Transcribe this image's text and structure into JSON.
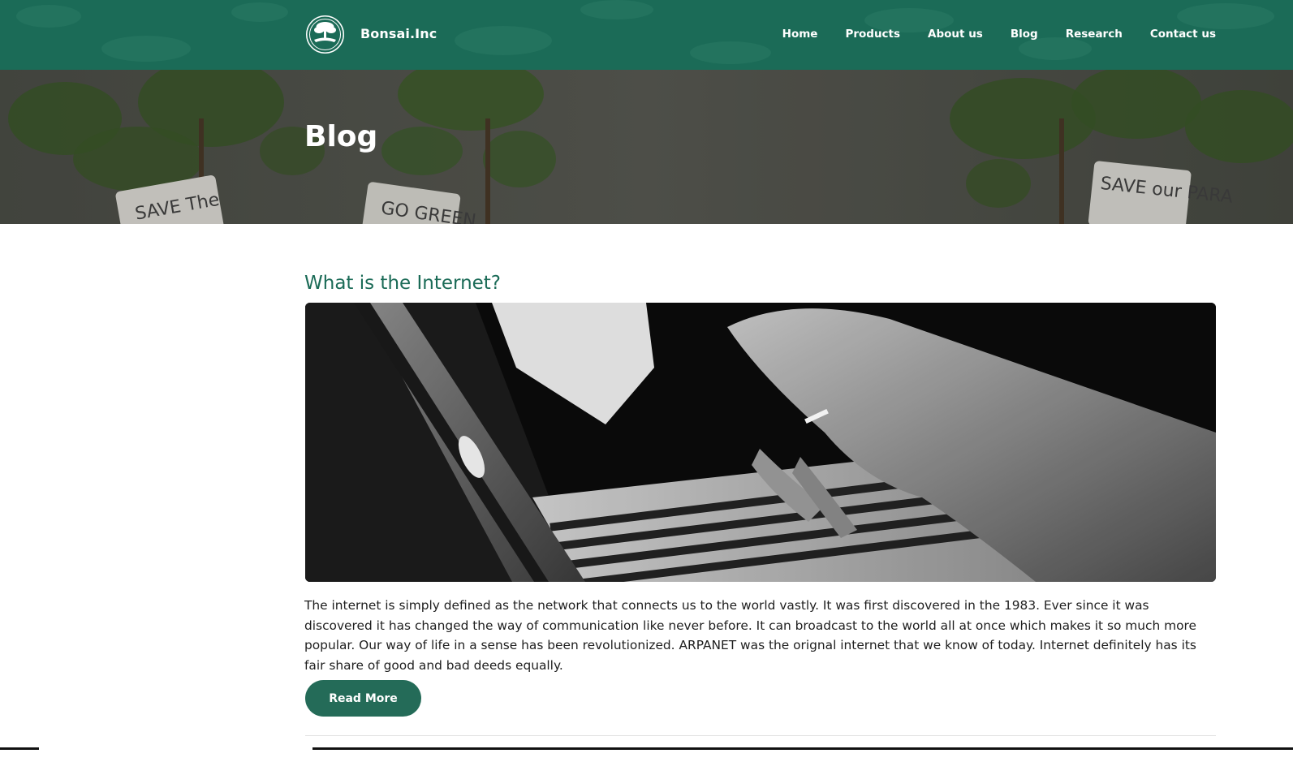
{
  "header": {
    "brand": "Bonsai.Inc",
    "logo_text": "Bonsai plants",
    "nav": [
      "Home",
      "Products",
      "About us",
      "Blog",
      "Research",
      "Contact us"
    ]
  },
  "hero": {
    "title": "Blog",
    "sign_texts": [
      "SAVE The",
      "GO GREEN",
      "SAVE our PARA"
    ]
  },
  "article": {
    "title": "What is the Internet?",
    "image_icon": "laptop-typing-photo",
    "body": "The internet is simply defined as the network that connects us to the world vastly. It was first discovered in the 1983. Ever since it was discovered it has changed the way of communication like never before. It can broadcast to the world all at once which makes it so much more popular. Our way of life in a sense has been revolutionized. ARPANET was the orignal internet that we know of today. Internet definitely has its fair share of good and bad deeds equally.",
    "read_more_label": "Read More"
  },
  "colors": {
    "brand_green": "#1b6b57",
    "button_green": "#246b58",
    "title_green": "#1b6b57"
  }
}
